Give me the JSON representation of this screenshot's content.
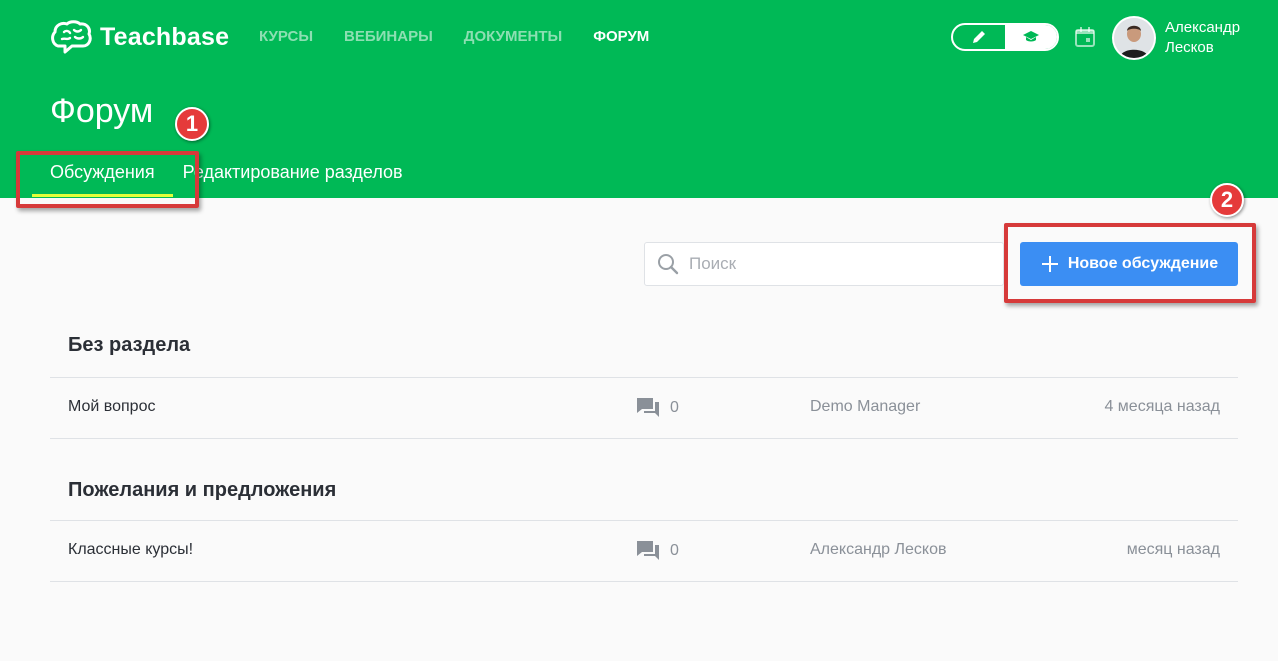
{
  "header": {
    "logo_text": "Teachbase",
    "nav": [
      {
        "label": "КУРСЫ",
        "active": false
      },
      {
        "label": "ВЕБИНАРЫ",
        "active": false
      },
      {
        "label": "ДОКУМЕНТЫ",
        "active": false
      },
      {
        "label": "ФОРУМ",
        "active": true
      }
    ],
    "user": {
      "first_name": "Александр",
      "last_name": "Лесков"
    }
  },
  "page": {
    "title": "Форум",
    "tabs": [
      {
        "label": "Обсуждения",
        "active": true
      },
      {
        "label": "Редактирование разделов",
        "active": false
      }
    ]
  },
  "annotations": {
    "badge_1": "1",
    "badge_2": "2"
  },
  "toolbar": {
    "search_placeholder": "Поиск",
    "new_discussion_label": "Новое обсуждение"
  },
  "sections": [
    {
      "title": "Без раздела",
      "topics": [
        {
          "title": "Мой вопрос",
          "comments": "0",
          "author": "Demo Manager",
          "time": "4 месяца назад"
        }
      ]
    },
    {
      "title": "Пожелания и предложения",
      "topics": [
        {
          "title": "Классные курсы!",
          "comments": "0",
          "author": "Александр Лесков",
          "time": "месяц назад"
        }
      ]
    }
  ],
  "colors": {
    "brand_green": "#00b956",
    "accent_blue": "#3b8ef3",
    "annotation_red": "#d63a3a",
    "tab_underline": "#e3ff3a"
  }
}
